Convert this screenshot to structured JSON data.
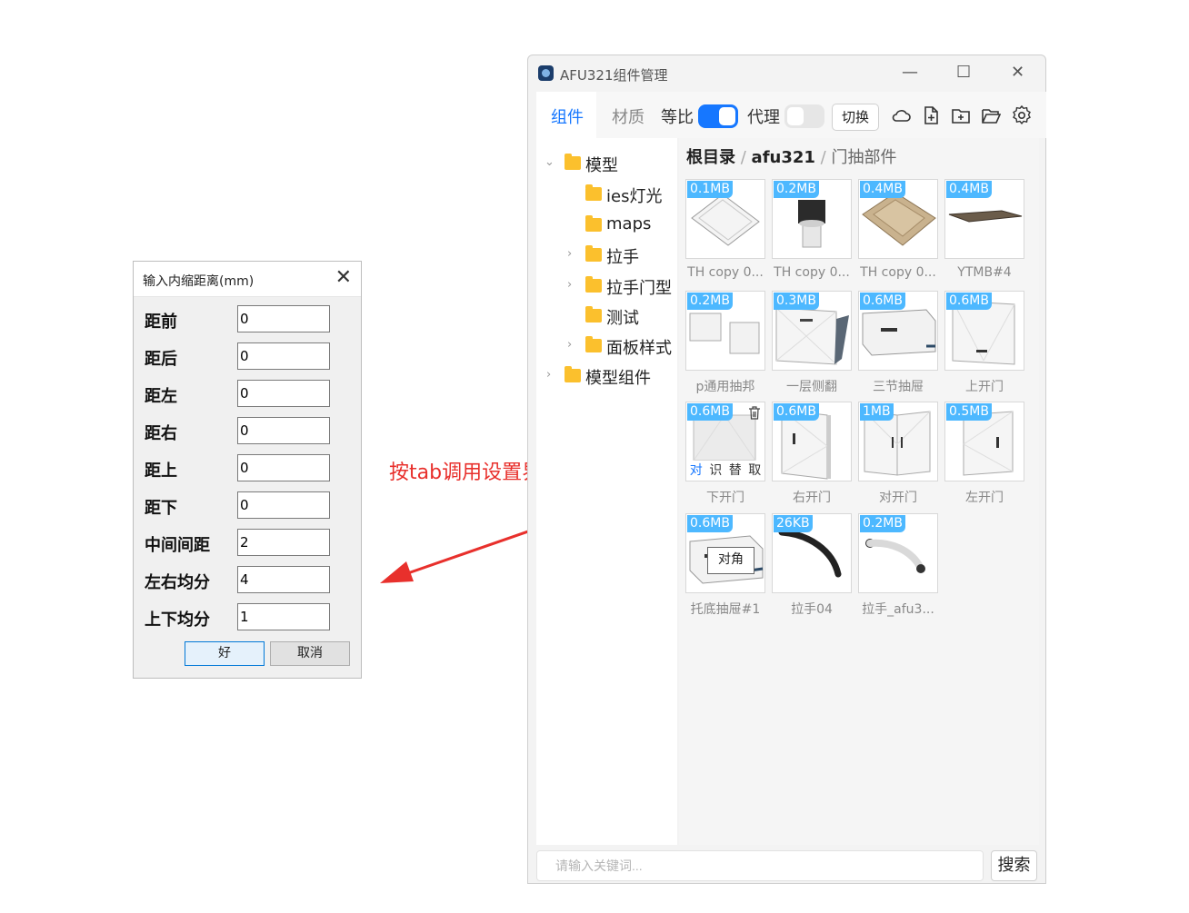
{
  "dialog": {
    "title": "输入内缩距离(mm)",
    "close_glyph": "✕",
    "fields": [
      {
        "label": "距前",
        "value": "0"
      },
      {
        "label": "距后",
        "value": "0"
      },
      {
        "label": "距左",
        "value": "0"
      },
      {
        "label": "距右",
        "value": "0"
      },
      {
        "label": "距上",
        "value": "0"
      },
      {
        "label": "距下",
        "value": "0"
      },
      {
        "label": "中间间距",
        "value": "2"
      },
      {
        "label": "左右均分",
        "value": "4"
      },
      {
        "label": "上下均分",
        "value": "1"
      }
    ],
    "ok_label": "好",
    "cancel_label": "取消"
  },
  "annotation": {
    "text": "按tab调用设置界面",
    "color": "#e8302c"
  },
  "window": {
    "title": "AFU321组件管理",
    "controls": {
      "minimize": "—",
      "maximize": "☐",
      "close": "✕"
    },
    "tabs": [
      {
        "label": "组件",
        "active": true
      },
      {
        "label": "材质",
        "active": false
      }
    ],
    "toggles": [
      {
        "label": "等比",
        "on": true
      },
      {
        "label": "代理",
        "on": false
      }
    ],
    "switch_button": "切换",
    "toolbar_icons": [
      "cloud-icon",
      "new-file-icon",
      "new-folder-icon",
      "open-folder-icon",
      "settings-icon"
    ],
    "accent": "#1677ff",
    "tree": [
      {
        "name": "模型",
        "level": 0,
        "chevron": "expanded"
      },
      {
        "name": "ies灯光",
        "level": 1,
        "chevron": "none"
      },
      {
        "name": "maps",
        "level": 1,
        "chevron": "none"
      },
      {
        "name": "拉手",
        "level": 1,
        "chevron": "collapsed"
      },
      {
        "name": "拉手门型",
        "level": 1,
        "chevron": "collapsed"
      },
      {
        "name": "测试",
        "level": 1,
        "chevron": "none"
      },
      {
        "name": "面板样式",
        "level": 1,
        "chevron": "collapsed"
      },
      {
        "name": "模型组件",
        "level": 0,
        "chevron": "collapsed"
      }
    ],
    "breadcrumb": {
      "root": "根目录",
      "sep": "/",
      "mid": "afu321",
      "current": "门抽部件"
    },
    "items": [
      {
        "size": "0.1MB",
        "name": "TH copy 0..."
      },
      {
        "size": "0.2MB",
        "name": "TH copy 0..."
      },
      {
        "size": "0.4MB",
        "name": "TH copy 0..."
      },
      {
        "size": "0.4MB",
        "name": "YTMB#4"
      },
      {
        "size": "0.2MB",
        "name": "p通用抽邦"
      },
      {
        "size": "0.3MB",
        "name": "一层侧翻"
      },
      {
        "size": "0.6MB",
        "name": "三节抽屉"
      },
      {
        "size": "0.6MB",
        "name": "上开门"
      },
      {
        "size": "0.6MB",
        "name": "下开门"
      },
      {
        "size": "0.6MB",
        "name": "右开门"
      },
      {
        "size": "1MB",
        "name": "对开门"
      },
      {
        "size": "0.5MB",
        "name": "左开门"
      },
      {
        "size": "0.6MB",
        "name": "托底抽屉#1"
      },
      {
        "size": "26KB",
        "name": "拉手04"
      },
      {
        "size": "0.2MB",
        "name": "拉手_afu3..."
      }
    ],
    "hover_actions": [
      "对",
      "识",
      "替",
      "取"
    ],
    "tooltip": "对角",
    "search": {
      "placeholder": "请输入关键词...",
      "button": "搜索"
    }
  }
}
